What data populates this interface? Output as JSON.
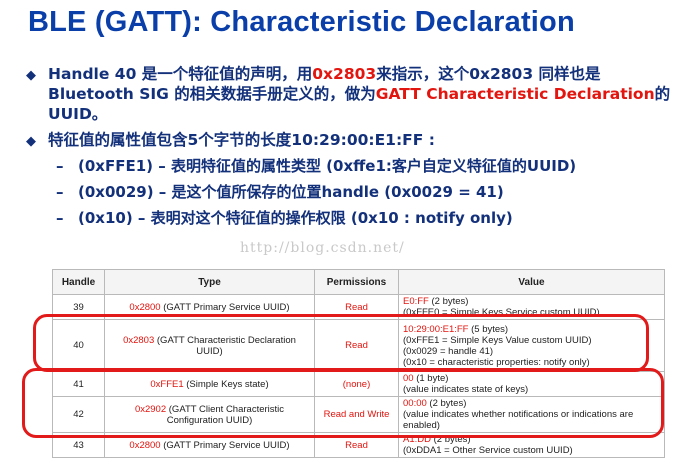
{
  "title": "BLE (GATT): Characteristic Declaration",
  "bullet1": {
    "p1": "Handle 40 是一个特征值的声明，用",
    "code": "0x2803",
    "p2": "来指示，这个0x2803 同样也是Bluetooth SIG 的相关数据手册定义的，做为",
    "red": "GATT Characteristic Declaration",
    "p3": "的UUID。"
  },
  "bullet2": "特征值的属性值包含5个字节的长度10:29:00:E1:FF :",
  "subitems": [
    "(0xFFE1) – 表明特征值的属性类型 (0xffe1:客户自定义特征值的UUID)",
    "(0x0029) –  是这个值所保存的位置handle (0x0029 = 41)",
    "(0x10) – 表明对这个特征值的操作权限 (0x10 : notify only)"
  ],
  "watermark": "http://blog.csdn.net/",
  "table": {
    "headers": [
      "Handle",
      "Type",
      "Permissions",
      "Value"
    ],
    "rows": [
      {
        "handle": "39",
        "type_code": "0x2800",
        "type_rest": "(GATT Primary Service UUID)",
        "perm": "Read",
        "val_code": "E0:FF",
        "val_code_rest": "(2 bytes)",
        "val_lines": [
          "(0xFFE0 = Simple Keys Service custom UUID)"
        ]
      },
      {
        "handle": "40",
        "type_code": "0x2803",
        "type_rest": "(GATT Characteristic Declaration UUID)",
        "perm": "Read",
        "val_code": "10:29:00:E1:FF",
        "val_code_rest": "(5 bytes)",
        "val_lines": [
          "(0xFFE1 = Simple Keys Value custom UUID)",
          "(0x0029 = handle 41)",
          "(0x10 = characteristic properties: notify only)"
        ]
      },
      {
        "handle": "41",
        "type_code": "0xFFE1",
        "type_rest": "(Simple Keys state)",
        "perm": "(none)",
        "val_code": "00",
        "val_code_rest": "(1 byte)",
        "val_lines": [
          "(value indicates state of keys)"
        ]
      },
      {
        "handle": "42",
        "type_code": "0x2902",
        "type_rest": "(GATT Client Characteristic Configuration UUID)",
        "perm": "Read and Write",
        "val_code": "00:00",
        "val_code_rest": "(2 bytes)",
        "val_lines": [
          "(value indicates whether notifications or indications are enabled)"
        ]
      },
      {
        "handle": "43",
        "type_code": "0x2800",
        "type_rest": "(GATT Primary Service UUID)",
        "perm": "Read",
        "val_code": "A1:DD",
        "val_code_rest": "(2 bytes)",
        "val_lines": [
          "(0xDDA1 = Other Service custom UUID)"
        ]
      }
    ]
  },
  "colors": {
    "title": "#0a3ea8",
    "body_text": "#13307a",
    "accent_red": "#e2150f",
    "highlight_border": "#e21a1a"
  }
}
